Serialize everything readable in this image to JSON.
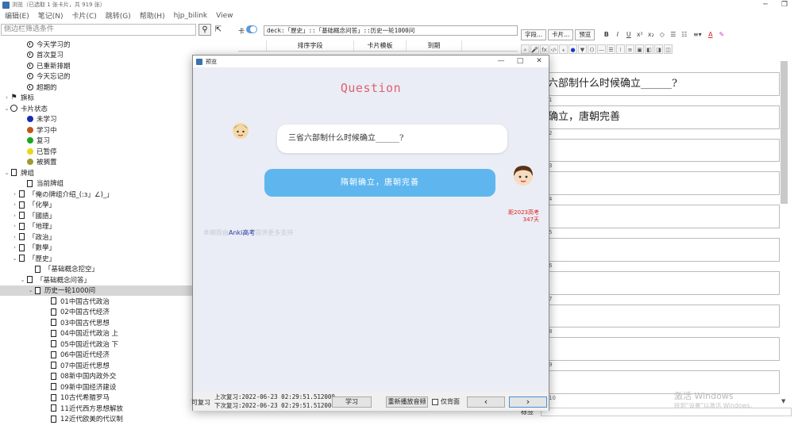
{
  "window": {
    "title": "浏览（已选取 1 张卡片，共 919 张）",
    "controls": [
      "─",
      "❐"
    ]
  },
  "menu": [
    "编辑(E)",
    "笔记(N)",
    "卡片(C)",
    "跳转(G)",
    "帮助(H)",
    "hjp_bilink",
    "View"
  ],
  "sidebar": {
    "search_placeholder": "侧边栏筛选条件",
    "search_icon": "search-icon",
    "tree": [
      {
        "label": "今天学习的",
        "icon": "clock",
        "indent": 2,
        "chev": ""
      },
      {
        "label": "首次复习",
        "icon": "clock",
        "indent": 2,
        "chev": ""
      },
      {
        "label": "已重新排期",
        "icon": "clock",
        "indent": 2,
        "chev": ""
      },
      {
        "label": "今天忘记的",
        "icon": "clock",
        "indent": 2,
        "chev": ""
      },
      {
        "label": "超期的",
        "icon": "clock",
        "indent": 2,
        "chev": ""
      },
      {
        "label": "旗标",
        "icon": "flag",
        "indent": 0,
        "chev": "›"
      },
      {
        "label": "卡片状态",
        "icon": "ring",
        "indent": 0,
        "chev": "⌄"
      },
      {
        "label": "未学习",
        "icon": "dot",
        "color": "#1b2ab5",
        "indent": 2,
        "chev": ""
      },
      {
        "label": "学习中",
        "icon": "dot",
        "color": "#c0561a",
        "indent": 2,
        "chev": ""
      },
      {
        "label": "复习",
        "icon": "dot",
        "color": "#19a81f",
        "indent": 2,
        "chev": ""
      },
      {
        "label": "已暂停",
        "icon": "dot",
        "color": "#e8d81a",
        "indent": 2,
        "chev": ""
      },
      {
        "label": "被搁置",
        "icon": "dot",
        "color": "#a09a30",
        "indent": 2,
        "chev": ""
      },
      {
        "label": "牌组",
        "icon": "deck",
        "indent": 0,
        "chev": "⌄"
      },
      {
        "label": "当前牌组",
        "icon": "deck",
        "indent": 2,
        "chev": ""
      },
      {
        "label": "「俺の牌组介绍_(:з」∠)_」",
        "icon": "deck",
        "indent": 1,
        "chev": "›"
      },
      {
        "label": "「化學」",
        "icon": "deck",
        "indent": 1,
        "chev": "›"
      },
      {
        "label": "「國語」",
        "icon": "deck",
        "indent": 1,
        "chev": "›"
      },
      {
        "label": "「地理」",
        "icon": "deck",
        "indent": 1,
        "chev": "›"
      },
      {
        "label": "「政治」",
        "icon": "deck",
        "indent": 1,
        "chev": "›"
      },
      {
        "label": "「數學」",
        "icon": "deck",
        "indent": 1,
        "chev": "›"
      },
      {
        "label": "「歷史」",
        "icon": "deck",
        "indent": 1,
        "chev": "⌄"
      },
      {
        "label": "「基础概念挖空」",
        "icon": "deck",
        "indent": 3,
        "chev": ""
      },
      {
        "label": "「基础概念问答」",
        "icon": "deck",
        "indent": 2,
        "chev": "⌄"
      },
      {
        "label": "历史一轮1000问",
        "icon": "deck",
        "indent": 3,
        "chev": "⌄",
        "selected": true
      },
      {
        "label": "01中国古代政治",
        "icon": "deck",
        "indent": 5,
        "chev": ""
      },
      {
        "label": "02中国古代经济",
        "icon": "deck",
        "indent": 5,
        "chev": ""
      },
      {
        "label": "03中国古代思想",
        "icon": "deck",
        "indent": 5,
        "chev": ""
      },
      {
        "label": "04中国近代政治 上",
        "icon": "deck",
        "indent": 5,
        "chev": ""
      },
      {
        "label": "05中国近代政治 下",
        "icon": "deck",
        "indent": 5,
        "chev": ""
      },
      {
        "label": "06中国近代经济",
        "icon": "deck",
        "indent": 5,
        "chev": ""
      },
      {
        "label": "07中国近代思想",
        "icon": "deck",
        "indent": 5,
        "chev": ""
      },
      {
        "label": "08新中国内政外交",
        "icon": "deck",
        "indent": 5,
        "chev": ""
      },
      {
        "label": "09新中国经济建设",
        "icon": "deck",
        "indent": 5,
        "chev": ""
      },
      {
        "label": "10古代希腊罗马",
        "icon": "deck",
        "indent": 5,
        "chev": ""
      },
      {
        "label": "11近代西方思想解放",
        "icon": "deck",
        "indent": 5,
        "chev": ""
      },
      {
        "label": "12近代欧美的代议制",
        "icon": "deck",
        "indent": 5,
        "chev": ""
      }
    ]
  },
  "browser": {
    "toggle_label": "卡",
    "query": "deck:「歷史」::「基础概念问答」::历史一轮1000问",
    "columns": [
      "",
      "排序字段",
      "卡片模板",
      "到期"
    ]
  },
  "editor": {
    "toolbar_buttons": [
      "字段...",
      "卡片...",
      "预览"
    ],
    "format_icons": [
      "B",
      "I",
      "U",
      "x²",
      "x₂",
      "◇",
      "☰",
      "☷",
      "≡▾",
      "A",
      "✎"
    ],
    "row2_icons": [
      "⌕",
      "🎤",
      "fx",
      "‹/›",
      "𝔰",
      "●",
      "▼",
      "()",
      "—",
      "☰",
      "⁞",
      "≡",
      "▣",
      "◧",
      "◨",
      "◫"
    ],
    "fields": [
      {
        "num": "",
        "text": "六部制什么时候确立______?"
      },
      {
        "num": "1",
        "text": "确立，唐朝完善"
      },
      {
        "num": "2",
        "text": ""
      },
      {
        "num": "3",
        "text": ""
      },
      {
        "num": "4",
        "text": ""
      },
      {
        "num": "5",
        "text": ""
      },
      {
        "num": "6",
        "text": ""
      },
      {
        "num": "7",
        "text": ""
      },
      {
        "num": "8",
        "text": ""
      },
      {
        "num": "9",
        "text": ""
      },
      {
        "num": "10",
        "text": ""
      }
    ],
    "tag_label": "标签",
    "watermark": "激活 Windows",
    "watermark_sub": "转到\"设置\"以激活 Windows。"
  },
  "preview": {
    "title": "预览",
    "heading": "Question",
    "question": "三省六部制什么时候确立______?",
    "answer": "隋朝确立，唐朝完善",
    "countdown_line1": "距2023高考",
    "countdown_line2": "347天",
    "footer_pre": "本模版由",
    "footer_link": "Anki高考",
    "footer_post": "提供更多支持",
    "side_label": "可复习",
    "last_review": "上次复习:2022-06-23 02:29:51.512000",
    "next_review": "下次复习:2022-06-23 02:29:51.512000",
    "btn_study": "学习",
    "btn_replay": "重新播放音频",
    "chk_back": "仅背面",
    "btn_prev": "‹",
    "btn_next": "›"
  }
}
